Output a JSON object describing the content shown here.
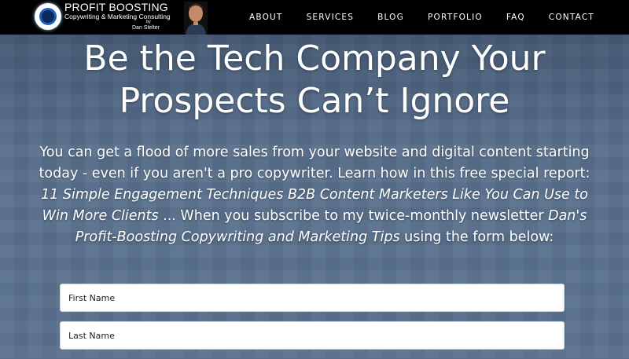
{
  "header": {
    "logo": {
      "title": "PROFIT BOOSTING",
      "subtitle": "Copywriting & Marketing Consulting",
      "by": "by",
      "author": "Dan Stelter"
    },
    "nav": [
      "ABOUT",
      "SERVICES",
      "BLOG",
      "PORTFOLIO",
      "FAQ",
      "CONTACT"
    ]
  },
  "hero": {
    "headline_line1": "Be the Tech Company Your",
    "headline_line2": "Prospects Can’t Ignore",
    "intro_part1": "You can get a flood of more sales from your website and digital content starting today - even if you aren't a pro copywriter. Learn how in this free special report: ",
    "report_title": "11 Simple Engagement Techniques B2B Content Marketers Like You Can Use to Win More Clients",
    "intro_part2": " ... When you subscribe to my twice-monthly newsletter ",
    "newsletter_title": "Dan's Profit-Boosting Copywriting and Marketing Tips",
    "intro_part3": " using the form below:"
  },
  "form": {
    "first_name_placeholder": "First Name",
    "last_name_placeholder": "Last Name"
  },
  "colors": {
    "topbar": "#000000",
    "background": "#5d7490",
    "text": "#ffffff"
  }
}
